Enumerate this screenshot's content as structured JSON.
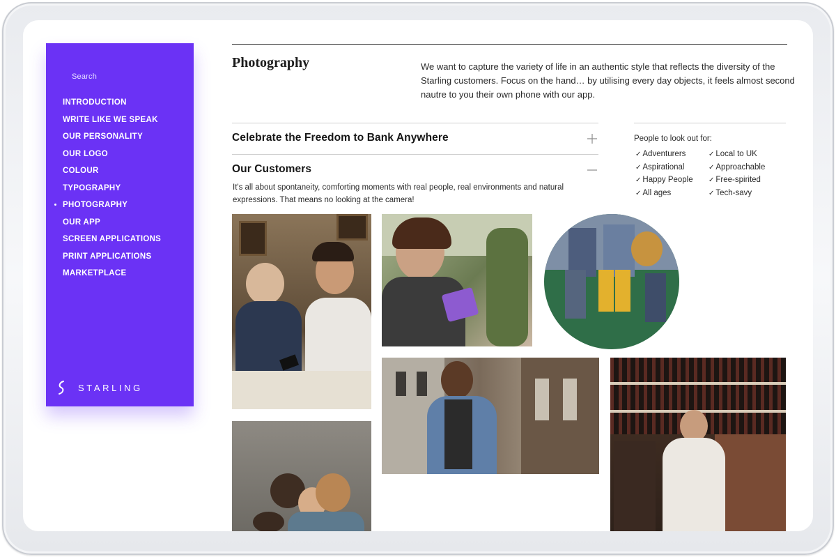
{
  "sidebar": {
    "search_label": "Search",
    "items": [
      {
        "label": "INTRODUCTION"
      },
      {
        "label": "WRITE LIKE WE SPEAK"
      },
      {
        "label": "OUR PERSONALITY"
      },
      {
        "label": "OUR LOGO"
      },
      {
        "label": "COLOUR"
      },
      {
        "label": "TYPOGRAPHY"
      },
      {
        "label": "PHOTOGRAPHY",
        "active": true
      },
      {
        "label": "OUR APP"
      },
      {
        "label": "SCREEN APPLICATIONS"
      },
      {
        "label": "PRINT APPLICATIONS"
      },
      {
        "label": "MARKETPLACE"
      }
    ],
    "brand_name": "STARLING",
    "brand_icon": "starling-logo-icon"
  },
  "page": {
    "title": "Photography",
    "intro": "We want to capture the variety of life in an authentic style that reflects the diversity of the Starling customers. Focus on the hand… by utilising every day objects, it feels almost second nautre to you their own phone with our app."
  },
  "accordion": {
    "section_1": {
      "title": "Celebrate the Freedom to Bank Anywhere",
      "toggle_icon": "plus-icon"
    },
    "section_2": {
      "title": "Our Customers",
      "toggle_icon": "minus-icon",
      "body": "It's all about spontaneity, comforting moments with real people, real environments and natural expressions. That means no looking at the camera!"
    }
  },
  "people": {
    "heading": "People to look out for:",
    "check_glyph": "✓",
    "traits": [
      "Adventurers",
      "Local to UK",
      "Aspirational",
      "Approachable",
      "Happy People",
      "Free-spirited",
      "All ages",
      "Tech-savy"
    ]
  },
  "colors": {
    "brand_purple": "#6b32f5",
    "text_dark": "#1c1c1c",
    "rule": "#cfcfcf"
  }
}
